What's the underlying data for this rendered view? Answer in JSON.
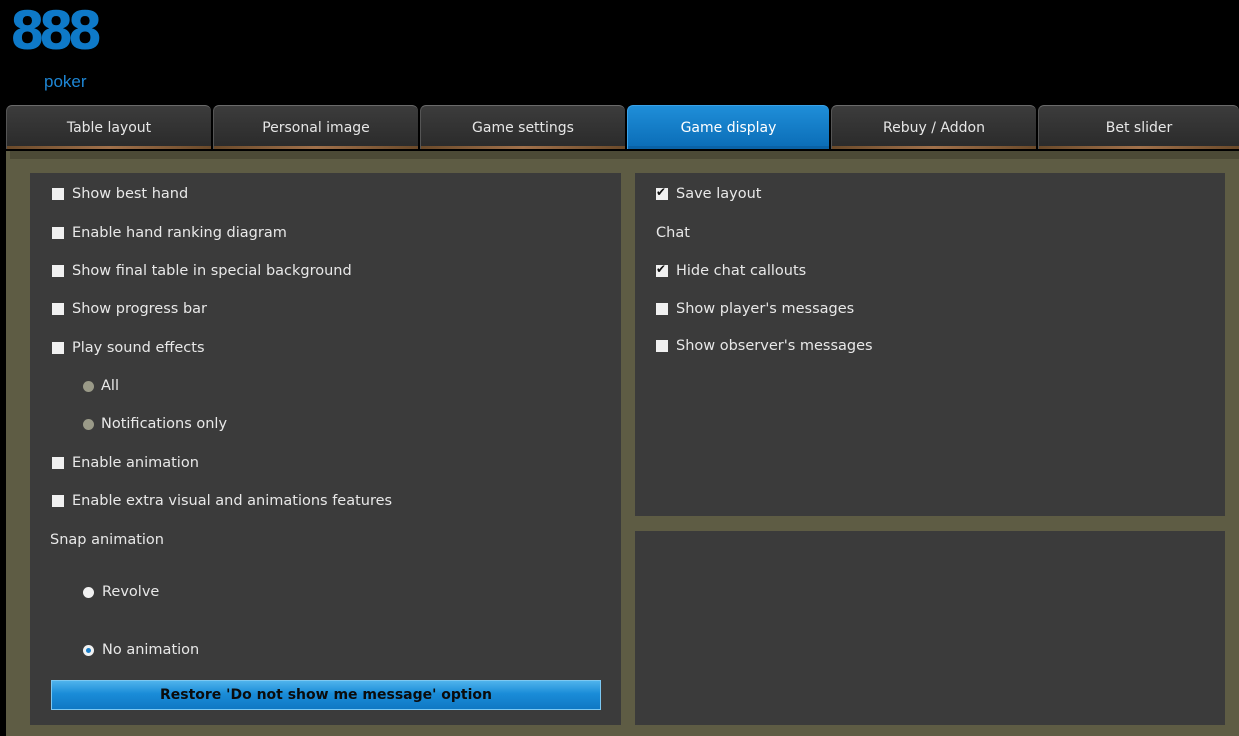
{
  "logo": {
    "number": "888",
    "word": "poker"
  },
  "tabs": [
    {
      "label": "Table layout"
    },
    {
      "label": "Personal image"
    },
    {
      "label": "Game settings"
    },
    {
      "label": "Game display"
    },
    {
      "label": "Rebuy / Addon"
    },
    {
      "label": "Bet slider"
    }
  ],
  "active_tab": "Game display",
  "left": {
    "show_best_hand": {
      "label": "Show best hand",
      "checked": false
    },
    "enable_hand_ranking": {
      "label": "Enable hand ranking diagram",
      "checked": false
    },
    "show_final_table": {
      "label": "Show final table in special background",
      "checked": false
    },
    "show_progress_bar": {
      "label": "Show progress bar",
      "checked": false
    },
    "play_sound_effects": {
      "label": "Play sound effects",
      "checked": false
    },
    "sound_all": {
      "label": "All"
    },
    "sound_notifications_only": {
      "label": "Notifications only"
    },
    "enable_animation": {
      "label": "Enable animation",
      "checked": false
    },
    "enable_extra_visual": {
      "label": "Enable extra visual and animations features",
      "checked": false
    },
    "snap_animation_title": "Snap animation",
    "snap_revolve": {
      "label": "Revolve",
      "selected": false
    },
    "snap_no_animation": {
      "label": "No animation",
      "selected": true
    },
    "restore_button": "Restore 'Do not show me message' option"
  },
  "right": {
    "save_layout": {
      "label": "Save layout",
      "checked": true
    },
    "chat_title": "Chat",
    "hide_chat_callouts": {
      "label": "Hide chat callouts",
      "checked": true
    },
    "show_players_messages": {
      "label": "Show player's messages",
      "checked": false
    },
    "show_observers_messages": {
      "label": "Show observer's messages",
      "checked": false
    }
  },
  "colors": {
    "accent": "#0e79c8",
    "frame": "#5e5c44",
    "panel": "#3b3b3b",
    "background": "#000000"
  }
}
